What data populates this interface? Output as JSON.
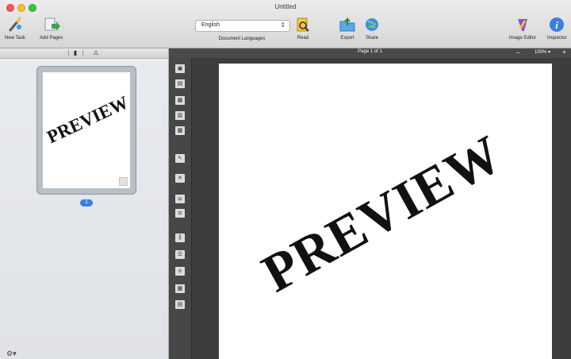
{
  "window": {
    "title": "Untitled"
  },
  "toolbar": {
    "new_task": "New Task",
    "add_pages": "Add Pages",
    "language_value": "English",
    "language_caption": "Document Languages",
    "read": "Read",
    "export": "Export",
    "share": "Share",
    "image_editor": "Image Editor",
    "inspector": "Inspector"
  },
  "sidebar": {
    "thumbnail_text": "PREVIEW",
    "page_badge": "1"
  },
  "page_header": {
    "counter": "Page 1 of 1",
    "zoom": "100%",
    "zoom_minus": "−",
    "zoom_plus": "+"
  },
  "document": {
    "text": "PREVIEW"
  },
  "colors": {
    "accent": "#3c7fe0",
    "page_bg": "#ffffff",
    "dark_panel": "#3d3d3d"
  }
}
